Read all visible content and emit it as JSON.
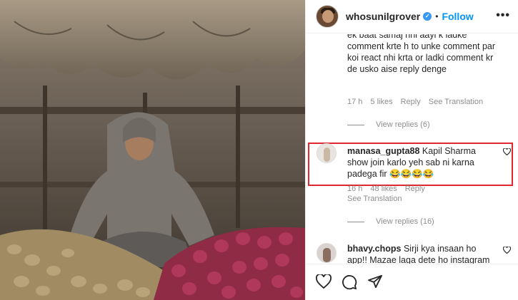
{
  "post": {
    "username": "whosunilgrover",
    "separator": "•",
    "follow_label": "Follow",
    "more_label": "•••"
  },
  "comments": [
    {
      "text": "ek baat samaj nhi aayi k ladke comment krte h to unke comment par koi react nhi krta or ladki comment kr de usko aise reply denge",
      "time": "17 h",
      "likes": "5 likes",
      "reply": "Reply",
      "translation": "See Translation",
      "view_replies": "View replies (6)"
    },
    {
      "username": "manasa_gupta88",
      "text": "Kapil Sharma show join karlo yeh sab ni karna padega fir 😂😂😂😂",
      "time": "16 h",
      "likes": "48 likes",
      "reply": "Reply",
      "translation": "See Translation",
      "view_replies": "View replies (16)",
      "highlight_color": "#e0262f"
    },
    {
      "username": "bhavy.chops",
      "text": "Sirji kya insaan ho app!! Mazae laga dete ho instagram"
    }
  ],
  "icons": {
    "verified": "verified-badge-icon",
    "like": "heart-icon",
    "comment": "comment-icon",
    "share": "share-icon"
  },
  "colors": {
    "accent": "#0095f6",
    "verified": "#3897f0",
    "muted": "#8e8e8e"
  }
}
